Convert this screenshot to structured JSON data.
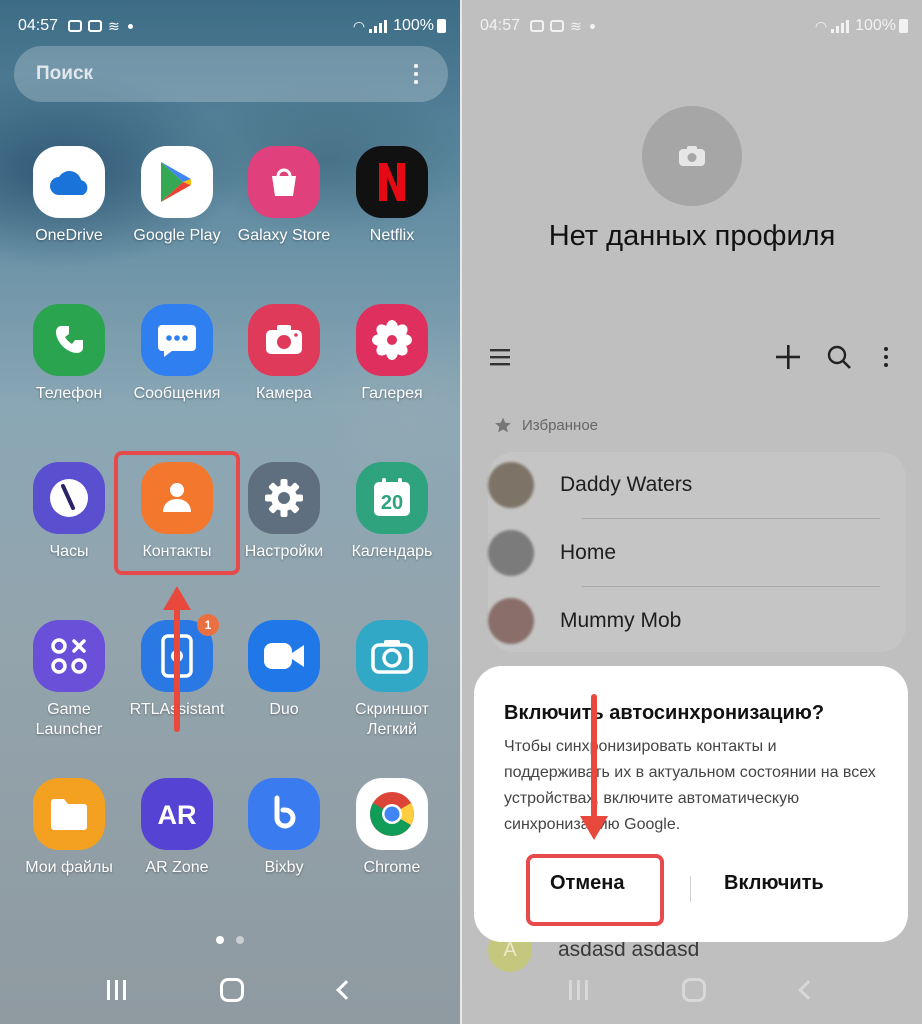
{
  "left_screen": {
    "status": {
      "time": "04:57",
      "battery": "100%"
    },
    "search": {
      "placeholder": "Поиск"
    },
    "apps": [
      {
        "label": "OneDrive",
        "icon": "onedrive-icon",
        "bg": "#ffffff"
      },
      {
        "label": "Google Play",
        "icon": "google-play-icon",
        "bg": "#ffffff"
      },
      {
        "label": "Galaxy Store",
        "icon": "galaxy-store-icon",
        "bg": "#e0407b"
      },
      {
        "label": "Netflix",
        "icon": "netflix-icon",
        "bg": "#111111"
      },
      {
        "label": "Телефон",
        "icon": "phone-icon",
        "bg": "#2aa44f"
      },
      {
        "label": "Сообщения",
        "icon": "messages-icon",
        "bg": "#2f7ff0"
      },
      {
        "label": "Камера",
        "icon": "camera-icon",
        "bg": "#e03a5a"
      },
      {
        "label": "Галерея",
        "icon": "gallery-icon",
        "bg": "#de2f5f"
      },
      {
        "label": "Часы",
        "icon": "clock-icon",
        "bg": "#5a4fcf"
      },
      {
        "label": "Контакты",
        "icon": "contacts-icon",
        "bg": "#f3782d"
      },
      {
        "label": "Настройки",
        "icon": "settings-icon",
        "bg": "#5f6f80"
      },
      {
        "label": "Календарь",
        "icon": "calendar-icon",
        "bg": "#2fa27e"
      },
      {
        "label": "Game\nLauncher",
        "icon": "game-launcher-icon",
        "bg": "#6a4fd9"
      },
      {
        "label": "RTLAssistant",
        "icon": "rtl-assistant-icon",
        "bg": "#2a78e4",
        "badge": "1"
      },
      {
        "label": "Duo",
        "icon": "duo-icon",
        "bg": "#1f77e8"
      },
      {
        "label": "Скриншот\nЛегкий",
        "icon": "screenshot-camera-icon",
        "bg": "#31a8c6"
      },
      {
        "label": "Мои файлы",
        "icon": "folder-icon",
        "bg": "#f4a121"
      },
      {
        "label": "AR Zone",
        "icon": "ar-zone-icon",
        "bg": "#5543d4"
      },
      {
        "label": "Bixby",
        "icon": "bixby-icon",
        "bg": "#3a7bf0"
      },
      {
        "label": "Chrome",
        "icon": "chrome-icon",
        "bg": "#ffffff"
      }
    ]
  },
  "right_screen": {
    "status": {
      "time": "04:57",
      "battery": "100%"
    },
    "profile": {
      "title": "Нет данных профиля"
    },
    "favorites_label": "Избранное",
    "contacts": [
      {
        "name": "Daddy Waters",
        "avatar_color": "#7d7467"
      },
      {
        "name": "Home",
        "avatar_color": "#7b7b7b"
      },
      {
        "name": "Mummy Mob",
        "avatar_color": "#8a6e6a"
      }
    ],
    "under_contact": {
      "initial": "A",
      "name": "asdasd asdasd"
    },
    "dialog": {
      "title": "Включить автосинхронизацию?",
      "body": "Чтобы синхронизировать контакты и поддерживать их в актуальном состоянии на всех устройствах, включите автоматическую синхронизацию Google.",
      "cancel": "Отмена",
      "confirm": "Включить"
    },
    "colors": {
      "highlight": "#e74a4a",
      "arrow": "#e8493c"
    }
  }
}
